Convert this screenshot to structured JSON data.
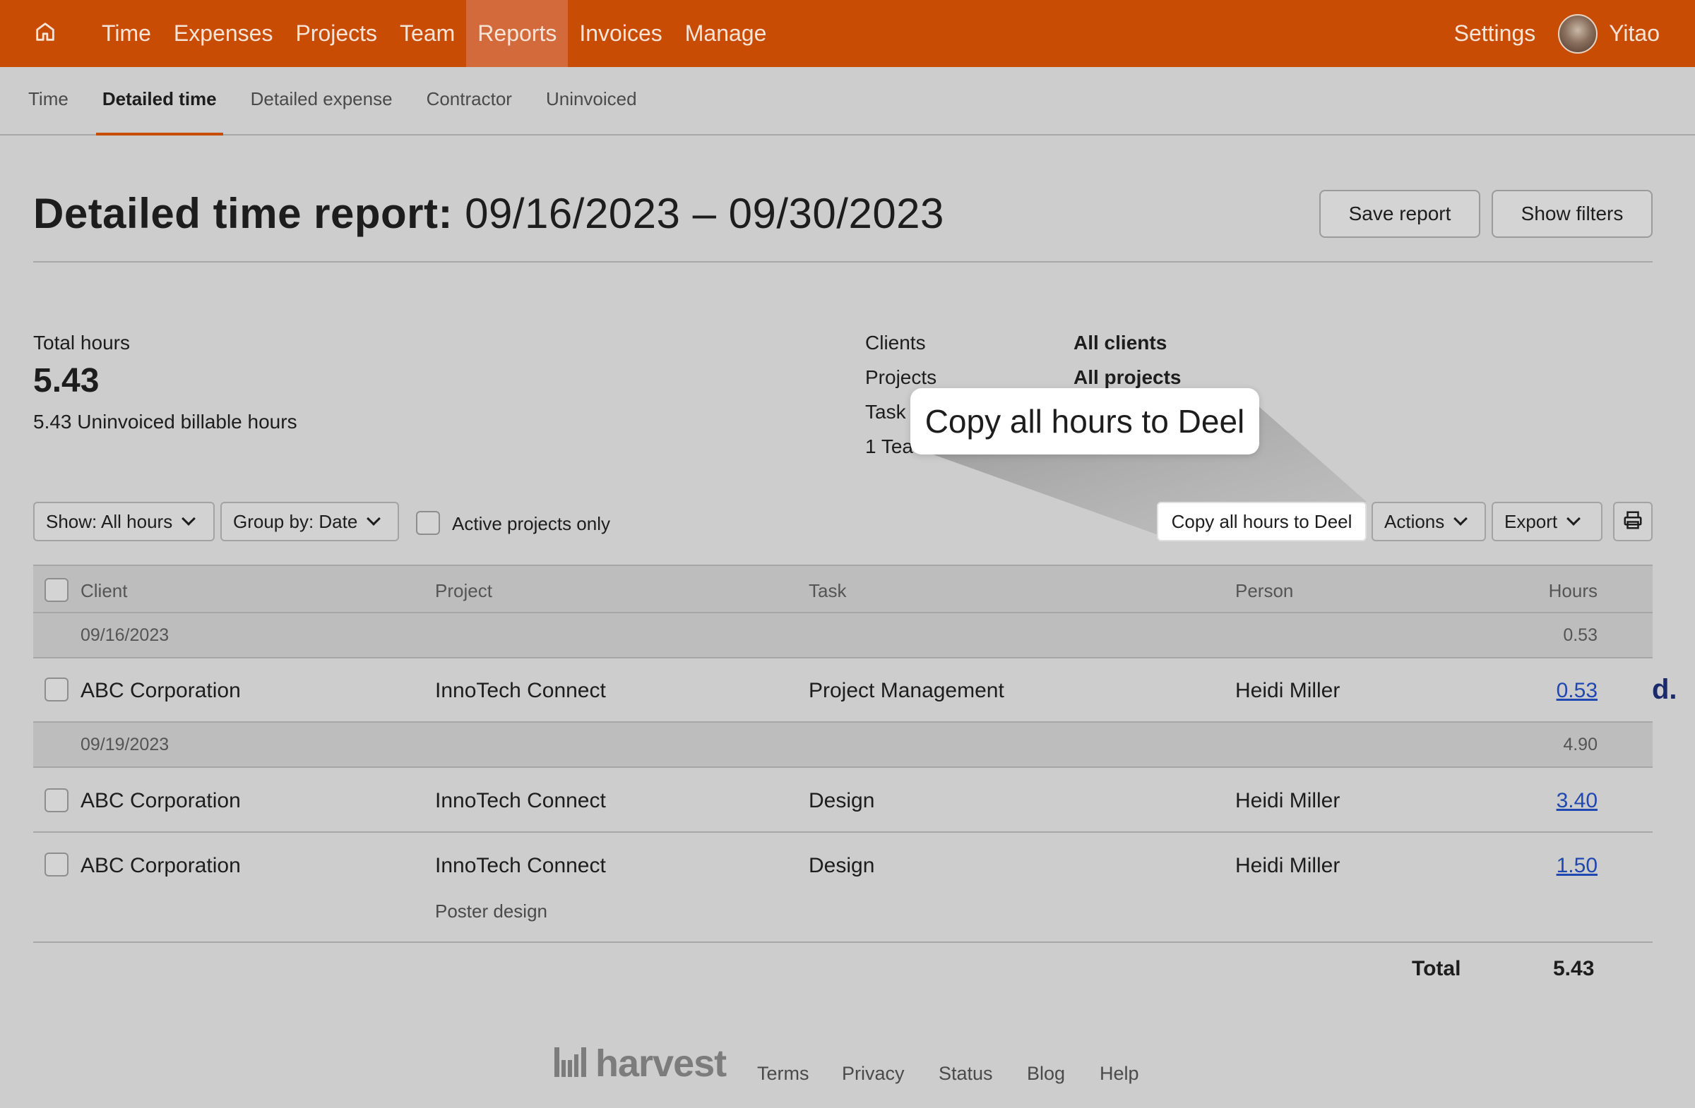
{
  "nav": {
    "items": [
      {
        "label": "Time",
        "active": false
      },
      {
        "label": "Expenses",
        "active": false
      },
      {
        "label": "Projects",
        "active": false
      },
      {
        "label": "Team",
        "active": false
      },
      {
        "label": "Reports",
        "active": true
      },
      {
        "label": "Invoices",
        "active": false
      },
      {
        "label": "Manage",
        "active": false
      }
    ],
    "settings": "Settings",
    "user": "Yitao",
    "home_icon": "home-icon",
    "accent": "#c94c05"
  },
  "subnav": {
    "tabs": [
      {
        "label": "Time",
        "active": false
      },
      {
        "label": "Detailed time",
        "active": true
      },
      {
        "label": "Detailed expense",
        "active": false
      },
      {
        "label": "Contractor",
        "active": false
      },
      {
        "label": "Uninvoiced",
        "active": false
      }
    ]
  },
  "header": {
    "title_prefix": "Detailed time report:",
    "title_range": "09/16/2023 – 09/30/2023",
    "save_report": "Save report",
    "show_filters": "Show filters"
  },
  "summary": {
    "total_label": "Total hours",
    "total_value": "5.43",
    "uninvoiced": "5.43 Uninvoiced billable hours",
    "filters": [
      {
        "label": "Clients",
        "value": "All clients"
      },
      {
        "label": "Projects",
        "value": "All projects"
      },
      {
        "label": "Task",
        "value": ""
      },
      {
        "label": "1 Tea",
        "value": ""
      }
    ]
  },
  "tooltip": {
    "text": "Copy all hours to Deel"
  },
  "controls": {
    "show": "Show: All hours",
    "group_by": "Group by: Date",
    "active_only": "Active projects only",
    "copy_deel": "Copy all hours to Deel",
    "actions": "Actions",
    "export": "Export",
    "print_icon": "printer-icon"
  },
  "table": {
    "headers": {
      "client": "Client",
      "project": "Project",
      "task": "Task",
      "person": "Person",
      "hours": "Hours"
    },
    "groups": [
      {
        "date": "09/16/2023",
        "hours": "0.53",
        "rows": [
          {
            "client": "ABC Corporation",
            "project": "InnoTech Connect",
            "task": "Project Management",
            "person": "Heidi Miller",
            "hours": "0.53",
            "deel": "d."
          }
        ]
      },
      {
        "date": "09/19/2023",
        "hours": "4.90",
        "rows": [
          {
            "client": "ABC Corporation",
            "project": "InnoTech Connect",
            "task": "Design",
            "person": "Heidi Miller",
            "hours": "3.40"
          },
          {
            "client": "ABC Corporation",
            "project": "InnoTech Connect",
            "task": "Design",
            "person": "Heidi Miller",
            "hours": "1.50",
            "note": "Poster design"
          }
        ]
      }
    ],
    "total_label": "Total",
    "total_value": "5.43"
  },
  "footer": {
    "logo": "harvest",
    "links": [
      "Terms",
      "Privacy",
      "Status",
      "Blog",
      "Help"
    ]
  }
}
